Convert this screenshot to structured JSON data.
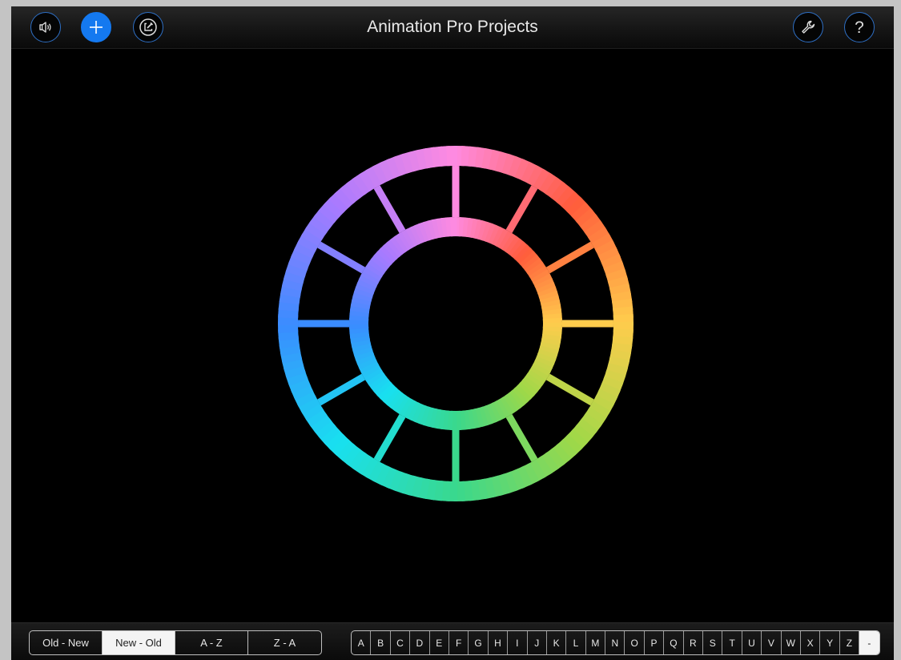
{
  "header": {
    "title": "Animation Pro Projects",
    "left_buttons": [
      {
        "icon": "speaker-icon"
      },
      {
        "icon": "plus-icon"
      },
      {
        "icon": "edit-icon"
      }
    ],
    "right_buttons": [
      {
        "icon": "wrench-icon"
      },
      {
        "icon": "help-icon",
        "glyph": "?"
      }
    ]
  },
  "colors": {
    "accent": "#1479f0",
    "ring_outline": "#2e6fc4",
    "background": "#000000",
    "wheel_gradient": [
      "#ff8ae0",
      "#ff5c3c",
      "#ffcc4c",
      "#9fd848",
      "#3ad88c",
      "#18e0f0",
      "#3a8cff",
      "#a87aff"
    ]
  },
  "sort": {
    "options": [
      "Old - New",
      "New - Old",
      "A - Z",
      "Z - A"
    ],
    "selected": "New - Old"
  },
  "alphabet": {
    "letters": [
      "A",
      "B",
      "C",
      "D",
      "E",
      "F",
      "G",
      "H",
      "I",
      "J",
      "K",
      "L",
      "M",
      "N",
      "O",
      "P",
      "Q",
      "R",
      "S",
      "T",
      "U",
      "V",
      "W",
      "X",
      "Y",
      "Z",
      "-"
    ],
    "selected": "-"
  }
}
